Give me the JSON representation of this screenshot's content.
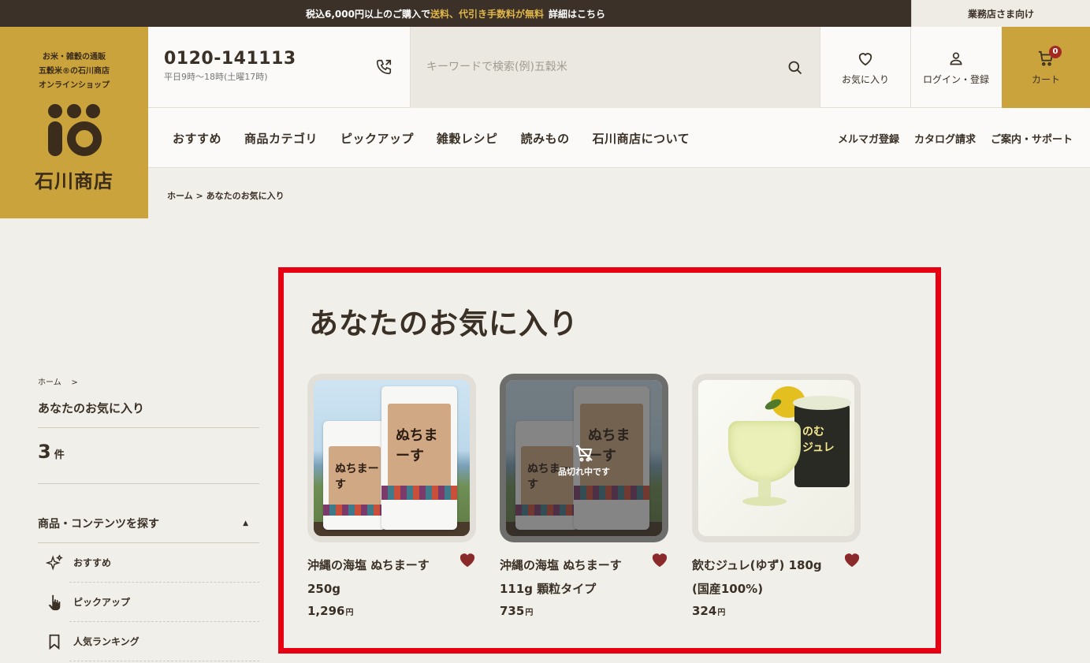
{
  "topbar": {
    "announce_pre": "税込6,000円以上のご購入で",
    "announce_highlight": "送料、代引き手数料が無料",
    "announce_link": "詳細はこちら",
    "business_link": "業務店さま向け"
  },
  "logo": {
    "tagline_1": "お米・雑穀の通販",
    "tagline_2": "五穀米®の石川商店",
    "tagline_3": "オンラインショップ",
    "name": "石川商店"
  },
  "header": {
    "phone_number": "0120-141113",
    "phone_hours": "平日9時～18時(土曜17時)",
    "search_placeholder": "キーワードで検索(例)五穀米",
    "favorites_label": "お気に入り",
    "login_label": "ログイン・登録",
    "cart_label": "カート",
    "cart_count": "0"
  },
  "nav": {
    "main": [
      "おすすめ",
      "商品カテゴリ",
      "ピックアップ",
      "雑穀レシピ",
      "読みもの",
      "石川商店について"
    ],
    "sub": [
      "メルマガ登録",
      "カタログ請求",
      "ご案内・サポート"
    ]
  },
  "breadcrumb": {
    "home": "ホーム",
    "sep": ">",
    "current": "あなたのお気に入り"
  },
  "sidebar": {
    "crumb_home": "ホーム",
    "crumb_sep": ">",
    "title": "あなたのお気に入り",
    "count": "3",
    "count_unit": "件",
    "explore_label": "商品・コンテンツを探す",
    "items": [
      {
        "label": "おすすめ",
        "icon": "sparkle-icon"
      },
      {
        "label": "ピックアップ",
        "icon": "pointer-hand-icon"
      },
      {
        "label": "人気ランキング",
        "icon": "bookmark-icon"
      }
    ]
  },
  "favorites": {
    "heading": "あなたのお気に入り",
    "soldout_label": "品切れ中です",
    "yen": "円",
    "products": [
      {
        "name_line1": "沖縄の海塩 ぬちまーす",
        "name_line2": "250g",
        "price": "1,296",
        "sold_out": false
      },
      {
        "name_line1": "沖縄の海塩 ぬちまーす",
        "name_line2": "111g 顆粒タイプ",
        "price": "735",
        "sold_out": true
      },
      {
        "name_line1": "飲むジュレ(ゆず) 180g",
        "name_line2": "(国産100%)",
        "price": "324",
        "sold_out": false
      }
    ]
  },
  "colors": {
    "topbar": "#3b3128",
    "gold": "#caa33c",
    "highlight": "#e60012",
    "heart": "#8b2a2a"
  }
}
